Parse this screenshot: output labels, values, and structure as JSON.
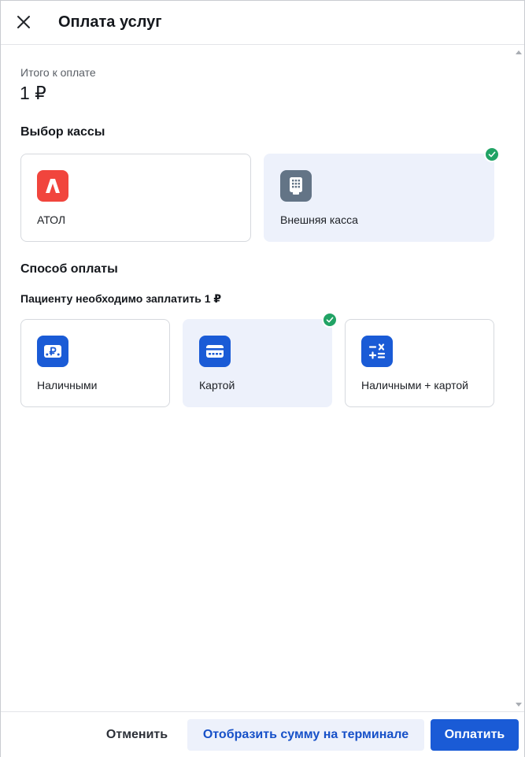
{
  "header": {
    "title": "Оплата услуг"
  },
  "summary": {
    "label": "Итого к оплате",
    "amount": "1 ₽"
  },
  "register": {
    "title": "Выбор кассы",
    "options": [
      {
        "label": "АТОЛ",
        "icon": "atol-logo-icon",
        "selected": false,
        "color": "#f1453d"
      },
      {
        "label": "Внешняя касса",
        "icon": "cash-register-icon",
        "selected": true,
        "color": "#637486"
      }
    ]
  },
  "payment": {
    "title": "Способ оплаты",
    "hint": "Пациенту необходимо заплатить 1 ₽",
    "options": [
      {
        "label": "Наличными",
        "icon": "cash-icon",
        "selected": false,
        "color": "#1a5bd6"
      },
      {
        "label": "Картой",
        "icon": "card-icon",
        "selected": true,
        "color": "#1a5bd6"
      },
      {
        "label": "Наличными + картой",
        "icon": "calculator-icon",
        "selected": false,
        "color": "#1a5bd6"
      }
    ]
  },
  "footer": {
    "cancel_label": "Отменить",
    "terminal_label": "Отобразить сумму на терминале",
    "pay_label": "Оплатить"
  },
  "colors": {
    "accent": "#1a5bd6",
    "selected_bg": "#edf1fb",
    "check": "#21a365"
  }
}
